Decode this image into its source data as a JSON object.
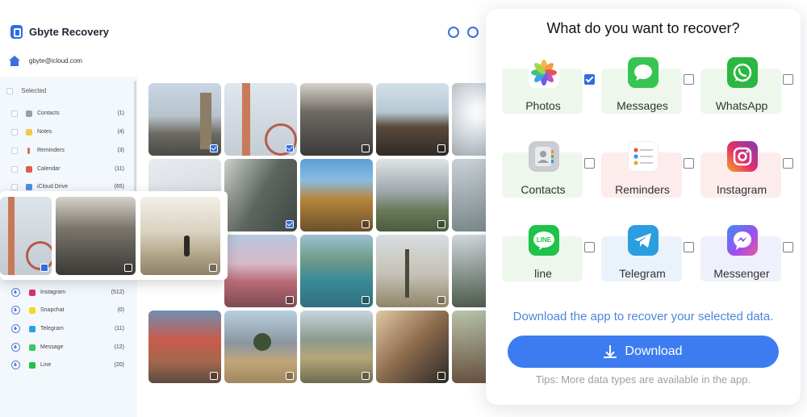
{
  "app": {
    "title": "Gbyte Recovery",
    "account_email": "gbyte@icloud.com",
    "selected_label": "Selected",
    "categories_top": [
      {
        "label": "Contacts",
        "count": "(1)",
        "icon": "contacts-icon",
        "color": "#9aa0aa"
      },
      {
        "label": "Notes",
        "count": "(4)",
        "icon": "notes-icon",
        "color": "#f4c84a"
      },
      {
        "label": "Reminders",
        "count": "(3)",
        "icon": "reminders-icon",
        "color": "#e46a5a"
      },
      {
        "label": "Calendar",
        "count": "(11)",
        "icon": "calendar-icon",
        "color": "#e05a4f"
      },
      {
        "label": "iCloud Drive",
        "count": "(65)",
        "icon": "icloud-drive-icon",
        "color": "#4d8de6"
      }
    ],
    "categories_bottom": [
      {
        "label": "Instagram",
        "count": "(512)",
        "icon": "instagram-icon",
        "color": "#d6336c"
      },
      {
        "label": "Snapchat",
        "count": "(0)",
        "icon": "snapchat-icon",
        "color": "#f7d51e"
      },
      {
        "label": "Telegram",
        "count": "(11)",
        "icon": "telegram-icon",
        "color": "#2aa3df"
      },
      {
        "label": "Message",
        "count": "(12)",
        "icon": "message-icon",
        "color": "#3cc85a"
      },
      {
        "label": "Line",
        "count": "(20)",
        "icon": "line-icon",
        "color": "#22c04a"
      }
    ]
  },
  "panel": {
    "title": "What do you want to recover?",
    "options": [
      {
        "label": "Photos",
        "icon": "photos-icon",
        "color": "#ffffff",
        "bg": "#eef7ec",
        "checked": true
      },
      {
        "label": "Messages",
        "icon": "messages-icon",
        "color": "#36c552",
        "bg": "#eef7ec",
        "checked": false
      },
      {
        "label": "WhatsApp",
        "icon": "whatsapp-icon",
        "color": "#2bb741",
        "bg": "#eef7ec",
        "checked": false
      },
      {
        "label": "Contacts",
        "icon": "contacts-icon",
        "color": "#b9bcc2",
        "bg": "#eef7ec",
        "checked": false
      },
      {
        "label": "Reminders",
        "icon": "reminders-icon",
        "color": "#ffffff",
        "bg": "#fdecec",
        "checked": false
      },
      {
        "label": "Instagram",
        "icon": "instagram-icon",
        "color": "#d9357a",
        "bg": "#fdecec",
        "checked": false
      },
      {
        "label": "line",
        "icon": "line-icon",
        "color": "#1fc24a",
        "bg": "#eef7ec",
        "checked": false
      },
      {
        "label": "Telegram",
        "icon": "telegram-icon",
        "color": "#2a9ee0",
        "bg": "#eaf3fb",
        "checked": false
      },
      {
        "label": "Messenger",
        "icon": "messenger-icon",
        "color": "#7b5cf0",
        "bg": "#eef1fb",
        "checked": false
      }
    ],
    "hint": "Download the app to recover your selected data.",
    "download_label": "Download",
    "tips": "Tips: More data types are available in the app.",
    "accent": "#3c7cf0"
  }
}
